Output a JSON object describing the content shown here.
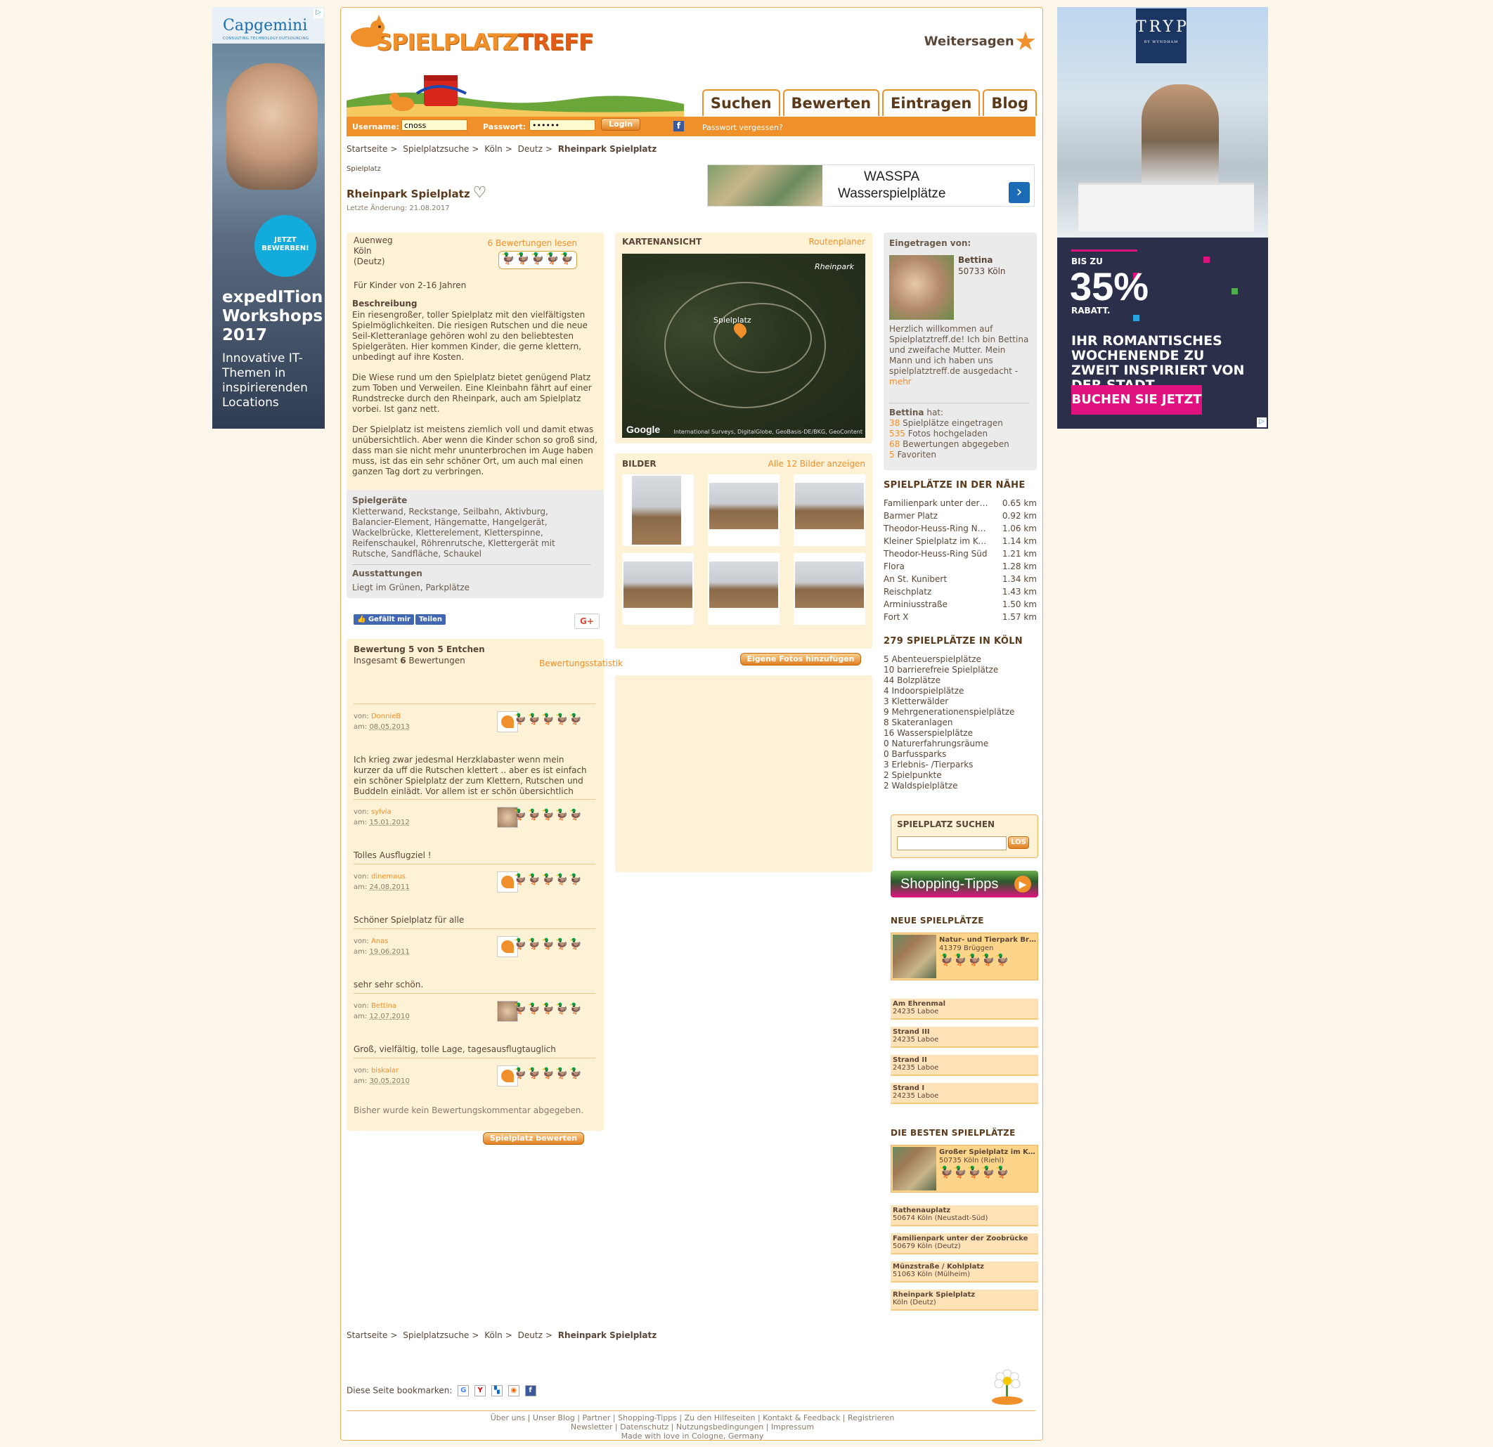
{
  "ads": {
    "left": {
      "brand": "Capgemini",
      "brand_sub": "CONSULTING.TECHNOLOGY.OUTSOURCING",
      "badge": "JETZT BEWERBEN!",
      "headline": "expedITion Workshops 2017",
      "body": "Innovative IT-Themen in inspirierenden Locations"
    },
    "right": {
      "brand": "TRYP",
      "brand_sub": "BY WYNDHAM",
      "pre": "BIS ZU",
      "percent": "35%",
      "rabatt": "RABATT.",
      "headline": "IHR ROMANTISCHES WOCHENENDE ZU ZWEIT INSPIRIERT VON DER STADT",
      "cta": "BUCHEN SIE JETZT",
      "accent": "#e0127f"
    }
  },
  "header": {
    "logo_a": "SPIELPLATZ",
    "logo_b": "TREFF",
    "share_label": "Weitersagen",
    "tabs": [
      "Suchen",
      "Bewerten",
      "Eintragen",
      "Blog"
    ],
    "login": {
      "username_label": "Username:",
      "username_value": "cnoss",
      "password_label": "Passwort:",
      "password_value": "••••••",
      "login_button": "Login",
      "forgot": "Passwort vergessen?"
    }
  },
  "breadcrumb": [
    "Startseite",
    "Spielplatzsuche",
    "Köln",
    "Deutz",
    "Rheinpark Spielplatz"
  ],
  "page": {
    "category": "Spielplatz",
    "title": "Rheinpark Spielplatz",
    "last_change": "Letzte Änderung: 21.08.2017"
  },
  "banner": {
    "line1": "WASSPA",
    "line2": "Wasserspielplätze"
  },
  "address": {
    "street": "Auenweg",
    "city": "Köln",
    "district": "(Deutz)",
    "reviews_link": "6 Bewertungen lesen",
    "ages": "Für Kinder von 2-16 Jahren"
  },
  "description": {
    "heading": "Beschreibung",
    "paragraphs": [
      "Ein riesengroßer, toller Spielplatz mit den vielfältigsten Spielmöglichkeiten. Die riesigen Rutschen und die neue Seil-Kletteranlage gehören wohl zu den beliebtesten Spielgeräten. Hier kommen Kinder, die gerne klettern, unbedingt auf ihre Kosten.",
      "Die Wiese rund um den Spielplatz bietet genügend Platz zum Toben und Verweilen. Eine Kleinbahn fährt auf einer Rundstrecke durch den Rheinpark, auch am Spielplatz vorbei. Ist ganz nett.",
      "Der Spielplatz ist meistens ziemlich voll und damit etwas unübersichtlich. Aber wenn die Kinder schon so groß sind, dass man sie nicht mehr ununterbrochen im Auge haben muss, ist das ein sehr schöner Ort, um auch mal einen ganzen Tag dort zu verbringen."
    ]
  },
  "equipment": {
    "heading": "Spielgeräte",
    "text": "Kletterwand, Reckstange, Seilbahn, Aktivburg, Balancier-Element, Hängematte, Hangelgerät, Wackelbrücke, Kletterelement, Kletterspinne, Reifenschaukel, Röhrenrutsche, Klettergerät mit Rutsche, Sandfläche, Schaukel",
    "features_heading": "Ausstattungen",
    "features_text": "Liegt im Grünen, Parkplätze"
  },
  "social": {
    "like": "Gefällt mir",
    "share": "Teilen",
    "gplus": "G+"
  },
  "ratings": {
    "title": "Bewertung 5 von 5 Entchen",
    "summary_pre": "Insgesamt",
    "summary_count": "6",
    "summary_post": "Bewertungen",
    "stats_link": "Bewertungsstatistik",
    "von": "von:",
    "am": "am:",
    "reviews": [
      {
        "user": "DonnieB",
        "date": "08.05.2013",
        "stars": 4,
        "avatar": "fox",
        "text": "Ich krieg zwar jedesmal Herzklabaster wenn mein kurzer da uff die Rutschen klettert .. aber es ist einfach ein schöner Spielplatz der zum Klettern, Rutschen und Buddeln einlädt. Vor allem ist er schön übersichtlich"
      },
      {
        "user": "sylvia",
        "date": "15.01.2012",
        "stars": 5,
        "avatar": "photo",
        "text": "Tolles Ausflugziel !"
      },
      {
        "user": "dinemaus",
        "date": "24.08.2011",
        "stars": 4,
        "avatar": "fox",
        "text": "Schöner Spielplatz für alle"
      },
      {
        "user": "Anas",
        "date": "19.06.2011",
        "stars": 5,
        "avatar": "fox",
        "text": "sehr sehr schön."
      },
      {
        "user": "Bettina",
        "date": "12.07.2010",
        "stars": 5,
        "avatar": "photo",
        "text": "Groß, vielfältig, tolle Lage, tagesausflugtauglich"
      },
      {
        "user": "biskalar",
        "date": "30.05.2010",
        "stars": 4,
        "avatar": "fox",
        "text": ""
      }
    ],
    "no_comment": "Bisher wurde kein Bewertungskommentar abgegeben.",
    "rate_button": "Spielplatz bewerten"
  },
  "map": {
    "heading": "KARTENANSICHT",
    "route_link": "Routenplaner",
    "label_park": "Rheinpark",
    "label_pin": "Spielplatz",
    "google": "Google",
    "copyright": "International Surveys, DigitalGlobe, GeoBasis-DE/BKG, GeoContent"
  },
  "pictures": {
    "heading": "BILDER",
    "all_link": "Alle 12 Bilder anzeigen",
    "add_button": "Eigene Fotos hinzufügen"
  },
  "owner": {
    "heading": "Eingetragen von:",
    "name": "Bettina",
    "location": "50733 Köln",
    "intro": "Herzlich willkommen auf Spielplatztreff.de! Ich bin Bettina und zweifache Mutter. Mein Mann und ich haben uns spielplatztreff.de ausgedacht -",
    "more": "mehr",
    "has": "hat:",
    "stats": [
      {
        "n": "38",
        "t": "Spielplätze eingetragen"
      },
      {
        "n": "535",
        "t": "Fotos hochgeladen"
      },
      {
        "n": "68",
        "t": "Bewertungen abgegeben"
      },
      {
        "n": "5",
        "t": "Favoriten"
      }
    ]
  },
  "nearby": {
    "heading": "SPIELPLÄTZE IN DER NÄHE",
    "items": [
      {
        "name": "Familienpark unter der Zoobrücke",
        "dist": "0.65 km"
      },
      {
        "name": "Barmer Platz",
        "dist": "0.92 km"
      },
      {
        "name": "Theodor-Heuss-Ring Nord",
        "dist": "1.06 km"
      },
      {
        "name": "Kleiner Spielplatz im Kölner Zoo",
        "dist": "1.14 km"
      },
      {
        "name": "Theodor-Heuss-Ring Süd",
        "dist": "1.21 km"
      },
      {
        "name": "Flora",
        "dist": "1.28 km"
      },
      {
        "name": "An St. Kunibert",
        "dist": "1.34 km"
      },
      {
        "name": "Reischplatz",
        "dist": "1.43 km"
      },
      {
        "name": "Arminiusstraße",
        "dist": "1.50 km"
      },
      {
        "name": "Fort X",
        "dist": "1.57 km"
      }
    ]
  },
  "city": {
    "heading": "279 SPIELPLÄTZE IN KÖLN",
    "items": [
      "5 Abenteuerspielplätze",
      "10 barrierefreie Spielplätze",
      "44 Bolzplätze",
      "4 Indoorspielplätze",
      "3 Kletterwälder",
      "9 Mehrgenerationenspielplätze",
      "8 Skateranlagen",
      "16 Wasserspielplätze",
      "0 Naturerfahrungsräume",
      "0 Barfussparks",
      "3 Erlebnis- /Tierparks",
      "2 Spielpunkte",
      "2 Waldspielplätze"
    ]
  },
  "search": {
    "heading": "SPIELPLATZ SUCHEN",
    "go": "LOS"
  },
  "shopping": {
    "label": "Shopping-Tipps"
  },
  "new_places": {
    "heading": "NEUE SPIELPLÄTZE",
    "featured": {
      "name": "Natur- und Tierpark Brüggen",
      "loc": "41379 Brüggen"
    },
    "items": [
      {
        "name": "Am Ehrenmal",
        "loc": "24235 Laboe"
      },
      {
        "name": "Strand III",
        "loc": "24235 Laboe"
      },
      {
        "name": "Strand II",
        "loc": "24235 Laboe"
      },
      {
        "name": "Strand I",
        "loc": "24235 Laboe"
      }
    ]
  },
  "best_places": {
    "heading": "DIE BESTEN SPIELPLÄTZE",
    "featured": {
      "name": "Großer Spielplatz im Kölner Zoo",
      "loc": "50735 Köln (Riehl)"
    },
    "items": [
      {
        "name": "Rathenauplatz",
        "loc": "50674 Köln (Neustadt-Süd)"
      },
      {
        "name": "Familienpark unter der Zoobrücke",
        "loc": "50679 Köln (Deutz)"
      },
      {
        "name": "Münzstraße / Kohlplatz",
        "loc": "51063 Köln (Mülheim)"
      },
      {
        "name": "Rheinpark Spielplatz",
        "loc": "Köln (Deutz)"
      }
    ]
  },
  "footer": {
    "bookmark_label": "Diese Seite bookmarken:",
    "links_row1": [
      "Über uns",
      "Unser Blog",
      "Partner",
      "Shopping-Tipps",
      "Zu den Hilfeseiten",
      "Kontakt & Feedback",
      "Registrieren"
    ],
    "links_row2": [
      "Newsletter",
      "Datenschutz",
      "Nutzungsbedingungen",
      "Impressum"
    ],
    "made": "Made with love in Cologne, Germany"
  }
}
